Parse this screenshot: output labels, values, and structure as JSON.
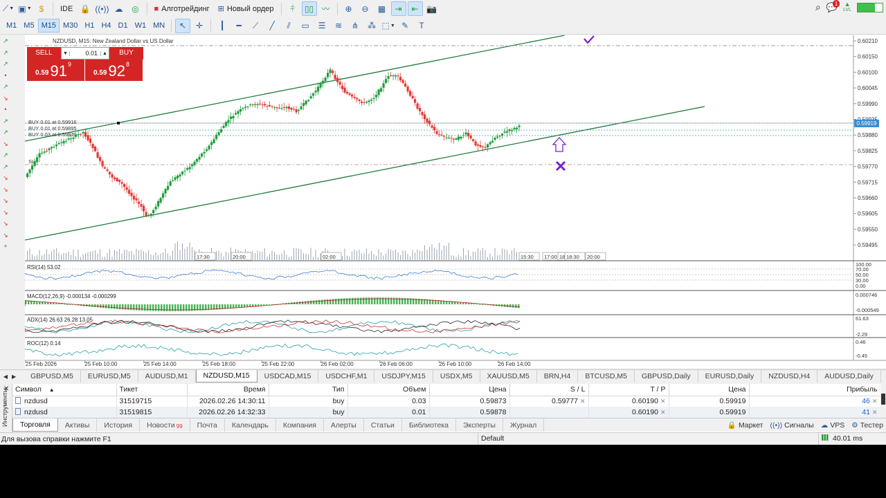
{
  "toolbar": {
    "ide_label": "IDE",
    "algo_label": "Алготрейдинг",
    "new_order_label": "Новый ордер",
    "notif_count": "1",
    "level_label": "LVL"
  },
  "timeframes": [
    "M1",
    "M5",
    "M15",
    "M30",
    "H1",
    "H4",
    "D1",
    "W1",
    "MN"
  ],
  "active_timeframe": "M15",
  "chart": {
    "title": "NZDUSD, M15:  New Zealand Dollar vs US Dollar",
    "current_price_tag": "0.59919",
    "price_axis": [
      "0.60210",
      "0.60150",
      "0.60100",
      "0.60045",
      "0.59990",
      "0.59935",
      "0.59880",
      "0.59825",
      "0.59770",
      "0.59715",
      "0.59660",
      "0.59605",
      "0.59550",
      "0.59495"
    ],
    "time_axis": [
      "25 Feb 2026",
      "25 Feb 10:00",
      "25 Feb 14:00",
      "25 Feb 18:00",
      "25 Feb 22:00",
      "26 Feb 02:00",
      "26 Feb 06:00",
      "26 Feb 10:00",
      "26 Feb 14:00"
    ],
    "inline_time_labels": [
      "17:30",
      "20:00",
      "02:00",
      "15:30",
      "17:00",
      "18",
      "18:30",
      "20:00"
    ],
    "order_lines": [
      "BUY 0.01 at 0.59916",
      "BUY 0.01 at 0.59895",
      "BUY 0.03 at 0.59879"
    ],
    "sl_label": "SL",
    "colors": {
      "bull": "#1f9e3d",
      "bear": "#e53935",
      "channel": "#1f7a3d",
      "marker": "#7a1fcf"
    }
  },
  "one_click": {
    "sell_label": "SELL",
    "buy_label": "BUY",
    "lot": "0.01",
    "sell_price_prefix": "0.59",
    "sell_price_big": "91",
    "sell_price_sup": "9",
    "buy_price_prefix": "0.59",
    "buy_price_big": "92",
    "buy_price_sup": "8"
  },
  "indicators": {
    "rsi": {
      "label": "RSI(14) 53.02",
      "axis": [
        "100.00",
        "70.00",
        "50.00",
        "30.00",
        "0.00"
      ]
    },
    "macd": {
      "label": "MACD(12,26,9) -0.000134 -0.000299",
      "axis": [
        "0.000746",
        "-0.000549"
      ]
    },
    "adx": {
      "label": "ADX(14) 26.63 26.28 13.05",
      "axis": [
        "61.63",
        "-2.29"
      ]
    },
    "roc": {
      "label": "ROC(12) 0.14",
      "axis": [
        "0.46",
        "-0.45"
      ]
    }
  },
  "symbol_tabs": [
    "GBPUSD,M5",
    "EURUSD,M5",
    "AUDUSD,M1",
    "NZDUSD,M15",
    "USDCAD,M15",
    "USDCHF,M1",
    "USDJPY,M15",
    "USDX,M5",
    "XAUUSD,M5",
    "BRN,H4",
    "BTCUSD,M5",
    "GBPUSD,Daily",
    "EURUSD,Daily",
    "NZDUSD,H4",
    "AUDUSD,Daily"
  ],
  "active_symbol_tab": "NZDUSD,M15",
  "terminal": {
    "side_label": "Инструменты",
    "columns": [
      "Символ",
      "Тикет",
      "Время",
      "Тип",
      "Объем",
      "Цена",
      "S / L",
      "T / P",
      "Цена",
      "Прибыль"
    ],
    "rows": [
      [
        "nzdusd",
        "31519715",
        "2026.02.26 14:30:11",
        "buy",
        "0.03",
        "0.59873",
        "0.59777",
        "0.60190",
        "0.59919",
        "46"
      ],
      [
        "nzdusd",
        "31519815",
        "2026.02.26 14:32:33",
        "buy",
        "0.01",
        "0.59878",
        "",
        "0.60190",
        "0.59919",
        "41"
      ]
    ]
  },
  "bottom_tabs": [
    "Торговля",
    "Активы",
    "История",
    "Новости",
    "Почта",
    "Календарь",
    "Компания",
    "Алерты",
    "Статьи",
    "Библиотека",
    "Эксперты",
    "Журнал"
  ],
  "news_count": "99",
  "bottom_right": [
    "Маркет",
    "Сигналы",
    "VPS",
    "Тестер"
  ],
  "status": {
    "help": "Для вызова справки нажмите F1",
    "profile": "Default",
    "ping": "40.01 ms"
  }
}
